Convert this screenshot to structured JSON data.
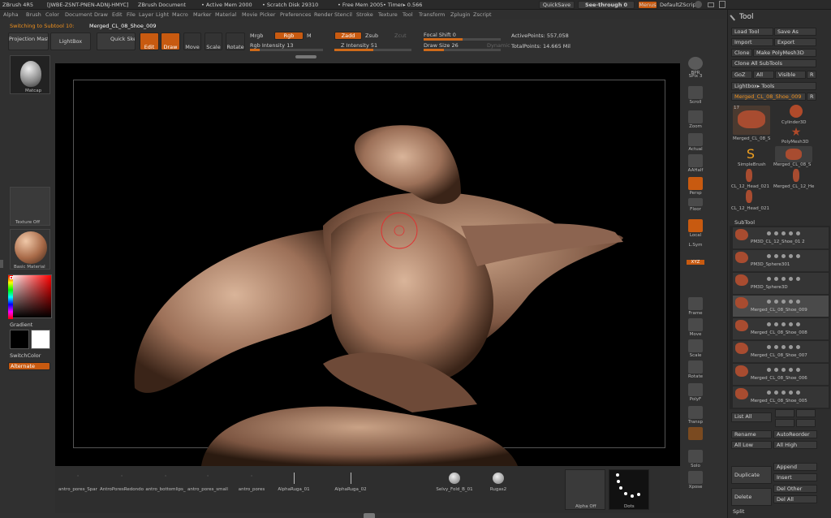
{
  "titlebar": {
    "app": "ZBrush 4R5",
    "serial": "[JWBE-ZSNT-PNEN-ADNJ-HMYC]",
    "doc": "ZBrush Document",
    "active_mem": "• Active Mem 2000",
    "scratch": "• Scratch Disk 29310",
    "free_mem": "• Free Mem 2005",
    "timer": "• Timer▸ 0.566",
    "quicksave": "QuickSave",
    "see_through": "See-through",
    "see_through_val": "0",
    "menus": "Menus",
    "default_script": "DefaultZScript"
  },
  "menubar": [
    "Alpha",
    "Brush",
    "Color",
    "Document",
    "Draw",
    "Edit",
    "File",
    "Layer",
    "Light",
    "Macro",
    "Marker",
    "Material",
    "Movie",
    "Picker",
    "Preferences",
    "Render",
    "Stencil",
    "Stroke",
    "Texture",
    "Tool",
    "Transform",
    "Zplugin",
    "Zscript"
  ],
  "status": "Switching to Subtool 10:",
  "status_name": "Merged_CL_08_Shoe_009",
  "toolbar": {
    "projection_master": "Projection Master",
    "lightbox": "LightBox",
    "quick_sketch": "Quick Sketch",
    "edit": "Edit",
    "draw": "Draw",
    "move": "Move",
    "scale": "Scale",
    "rotate": "Rotate",
    "mrgb": "Mrgb",
    "rgb": "Rgb",
    "m": "M",
    "rgb_intensity": "Rgb Intensity 13",
    "zadd": "Zadd",
    "zsub": "Zsub",
    "zcut": "Zcut",
    "z_intensity": "Z Intensity 51",
    "focal_shift": "Focal Shift 0",
    "draw_size": "Draw Size 26",
    "dynamic": "Dynamic",
    "active_points": "ActivePoints: 557,058",
    "total_points": "TotalPoints: 14.665 Mil"
  },
  "progress": {
    "rgb_intensity": 0.13,
    "z_intensity": 0.51,
    "focal_shift": 0.5,
    "draw_size": 0.26
  },
  "leftpanel": {
    "material_label": "Matcap",
    "texture_label": "Texture Off",
    "brush_label": "Basic Material",
    "gradient": "Gradient",
    "switch_color": "SwitchColor",
    "alternate": "Alternate"
  },
  "shelf": [
    {
      "name": "bpr",
      "label": "BPR"
    },
    {
      "name": "spix",
      "label": "SPix 3"
    },
    {
      "name": "scroll",
      "label": "Scroll"
    },
    {
      "name": "zoom",
      "label": "Zoom"
    },
    {
      "name": "actual",
      "label": "Actual"
    },
    {
      "name": "aahalf",
      "label": "AAHalf"
    },
    {
      "name": "persp",
      "label": "Persp"
    },
    {
      "name": "floor",
      "label": "Floor"
    },
    {
      "name": "local",
      "label": "Local"
    },
    {
      "name": "lsym",
      "label": "L.Sym"
    },
    {
      "name": "xyz",
      "label": "XYZ"
    },
    {
      "name": "frame",
      "label": "Frame"
    },
    {
      "name": "move",
      "label": "Move"
    },
    {
      "name": "scale",
      "label": "Scale"
    },
    {
      "name": "rotate",
      "label": "Rotate"
    },
    {
      "name": "polyf",
      "label": "PolyF"
    },
    {
      "name": "transp",
      "label": "Transp"
    },
    {
      "name": "ghost",
      "label": "Ghost"
    },
    {
      "name": "solo",
      "label": "Solo"
    },
    {
      "name": "xpose",
      "label": "Xpose"
    }
  ],
  "tool": {
    "title": "Tool",
    "load": "Load Tool",
    "save": "Save As",
    "import": "Import",
    "export": "Export",
    "clone": "Clone",
    "make_polymesh": "Make PolyMesh3D",
    "clone_all": "Clone All SubTools",
    "goz": "GoZ",
    "all": "All",
    "visible": "Visible",
    "r": "R",
    "lightbox_tools": "Lightbox▸ Tools",
    "current": "Merged_CL_08_Shoe_009",
    "thumb_num": "17",
    "thumbs": [
      "Merged_CL_08_S",
      "Cylinder3D",
      "PolyMesh3D",
      "SimpleBrush",
      "Merged_CL_08_S",
      "CL_12_Head_021",
      "Merged_CL_12_He",
      "CL_12_Head_021"
    ],
    "subtool_header": "SubTool",
    "subtools": [
      "PM3D_CL_12_Shoe_01 2",
      "PM3D_Sphere301",
      "PM3D_Sphere3D",
      "Merged_CL_08_Shoe_009",
      "Merged_CL_08_Shoe_008",
      "Merged_CL_08_Shoe_007",
      "Merged_CL_08_Shoe_006",
      "Merged_CL_08_Shoe_005"
    ],
    "list_all": "List All",
    "rename": "Rename",
    "auto_reorder": "AutoReorder",
    "all_low": "All Low",
    "all_high": "All High",
    "duplicate": "Duplicate",
    "append": "Append",
    "insert": "Insert",
    "delete": "Delete",
    "del_other": "Del Other",
    "del_all": "Del All",
    "split": "Split"
  },
  "tray": [
    "antro_pores_Spar",
    "AntroPoresRedondo",
    "antro_bottomlips_",
    "antro_pores_small",
    "antro_pores",
    "AlphaRuga_01",
    "AlphaRuga_02",
    "Selvy_Fold_B_01",
    "Rugas2"
  ],
  "tray_bottom": {
    "alpha_off": "Alpha Off",
    "dots": "Dots"
  }
}
